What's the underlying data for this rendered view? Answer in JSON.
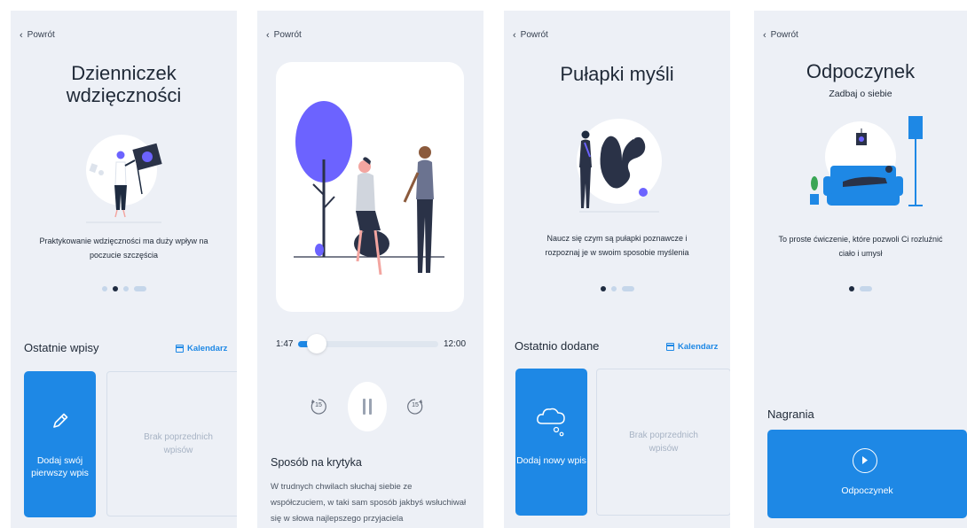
{
  "screens": [
    {
      "back": "Powrót",
      "title_line1": "Dzienniczek",
      "title_line2": "wdzięczności",
      "description": "Praktykowanie wdzięczności ma duży wpływ na poczucie szczęścia",
      "section_title": "Ostatnie wpisy",
      "calendar_label": "Kalendarz",
      "add_card_label": "Dodaj swój pierwszy wpis",
      "add_card_icon": "pencil-icon",
      "empty_label": "Brak poprzednich wpisów"
    },
    {
      "back": "Powrót",
      "player": {
        "current_time": "1:47",
        "total_time": "12:00",
        "progress": 0.13,
        "rewind_label": "15",
        "forward_label": "15"
      },
      "episode_title": "Sposób na krytyka",
      "episode_text": "W trudnych chwilach słuchaj siebie ze współczuciem, w taki sam sposób jakbyś wsłuchiwał się w słowa najlepszego przyjaciela"
    },
    {
      "back": "Powrót",
      "title": "Pułapki myśli",
      "description": "Naucz się czym są pułapki poznawcze i rozpoznaj je w swoim sposobie myślenia",
      "section_title": "Ostatnio dodane",
      "calendar_label": "Kalendarz",
      "add_card_label": "Dodaj nowy wpis",
      "add_card_icon": "thought-cloud-icon",
      "empty_label": "Brak poprzednich wpisów"
    },
    {
      "back": "Powrót",
      "title": "Odpoczynek",
      "subtitle": "Zadbaj o siebie",
      "description": "To proste ćwiczenie, które pozwoli Ci rozluźnić ciało i umysł",
      "section_title": "Nagrania",
      "recording_label": "Odpoczynek",
      "recording_icon": "play-icon"
    }
  ],
  "colors": {
    "accent": "#1e88e5",
    "background": "#edf0f6",
    "purple": "#6c63ff",
    "dark": "#1e2b40"
  }
}
